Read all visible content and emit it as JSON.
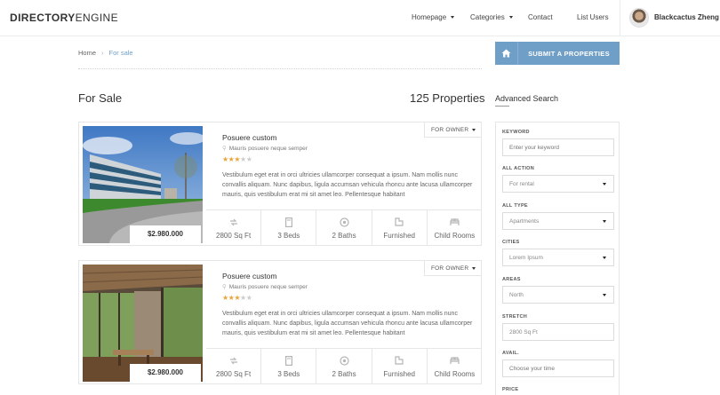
{
  "header": {
    "logo_bold": "DIRECTORY",
    "logo_light": "ENGINE",
    "nav": [
      {
        "label": "Homepage",
        "dropdown": true
      },
      {
        "label": "Categories",
        "dropdown": true
      },
      {
        "label": "Contact",
        "dropdown": false
      },
      {
        "label": "List Users",
        "dropdown": false
      }
    ],
    "username": "Blackcactus Zheng"
  },
  "breadcrumb": {
    "home": "Home",
    "separator": "›",
    "current": "For sale"
  },
  "submit_label": "SUBMIT A PROPERTIES",
  "section_title": "For Sale",
  "property_count": "125 Properties",
  "listings": [
    {
      "title": "Posuere custom",
      "location": "Mauris posuere neque semper",
      "rating": 3,
      "rating_max": 5,
      "owner_label": "FOR OWNER",
      "price": "$2.980.000",
      "description": "Vestibulum eget erat in orci ultricies ullamcorper consequat a ipsum. Nam mollis nunc convallis aliquam. Nunc dapibus, ligula accumsan vehicula rhoncu ante lacusa ullamcorper mauris, quis vestibulum erat mi sit amet leo. Pellentesque habitant",
      "features": [
        "2800 Sq Ft",
        "3 Beds",
        "2 Baths",
        "Furnished",
        "Child Rooms"
      ]
    },
    {
      "title": "Posuere custom",
      "location": "Mauris posuere neque semper",
      "rating": 3,
      "rating_max": 5,
      "owner_label": "FOR OWNER",
      "price": "$2.980.000",
      "description": "Vestibulum eget erat in orci ultricies ullamcorper consequat a ipsum. Nam mollis nunc convallis aliquam. Nunc dapibus, ligula accumsan vehicula rhoncu ante lacusa ullamcorper mauris, quis vestibulum erat mi sit amet leo. Pellentesque habitant",
      "features": [
        "2800 Sq Ft",
        "3 Beds",
        "2 Baths",
        "Furnished",
        "Child Rooms"
      ]
    }
  ],
  "feature_icons": [
    "area-icon",
    "bed-icon",
    "bath-icon",
    "furnished-icon",
    "child-room-icon"
  ],
  "advanced_search": {
    "title": "Advanced Search",
    "keyword_label": "KEYWORD",
    "keyword_placeholder": "Enter your keyword",
    "action_label": "ALL ACTION",
    "action_value": "For rental",
    "type_label": "ALL TYPE",
    "type_value": "Apartments",
    "cities_label": "CITIES",
    "cities_value": "Lorem Ipsum",
    "areas_label": "AREAS",
    "areas_value": "North",
    "stretch_label": "STRETCH",
    "stretch_value": "2800 Sq Ft",
    "avail_label": "AVAIL.",
    "avail_placeholder": "Choose your time",
    "price_label": "PRICE"
  },
  "colors": {
    "accent": "#6f9ec6",
    "star": "#e8a43a",
    "link": "#6fa1c8"
  }
}
